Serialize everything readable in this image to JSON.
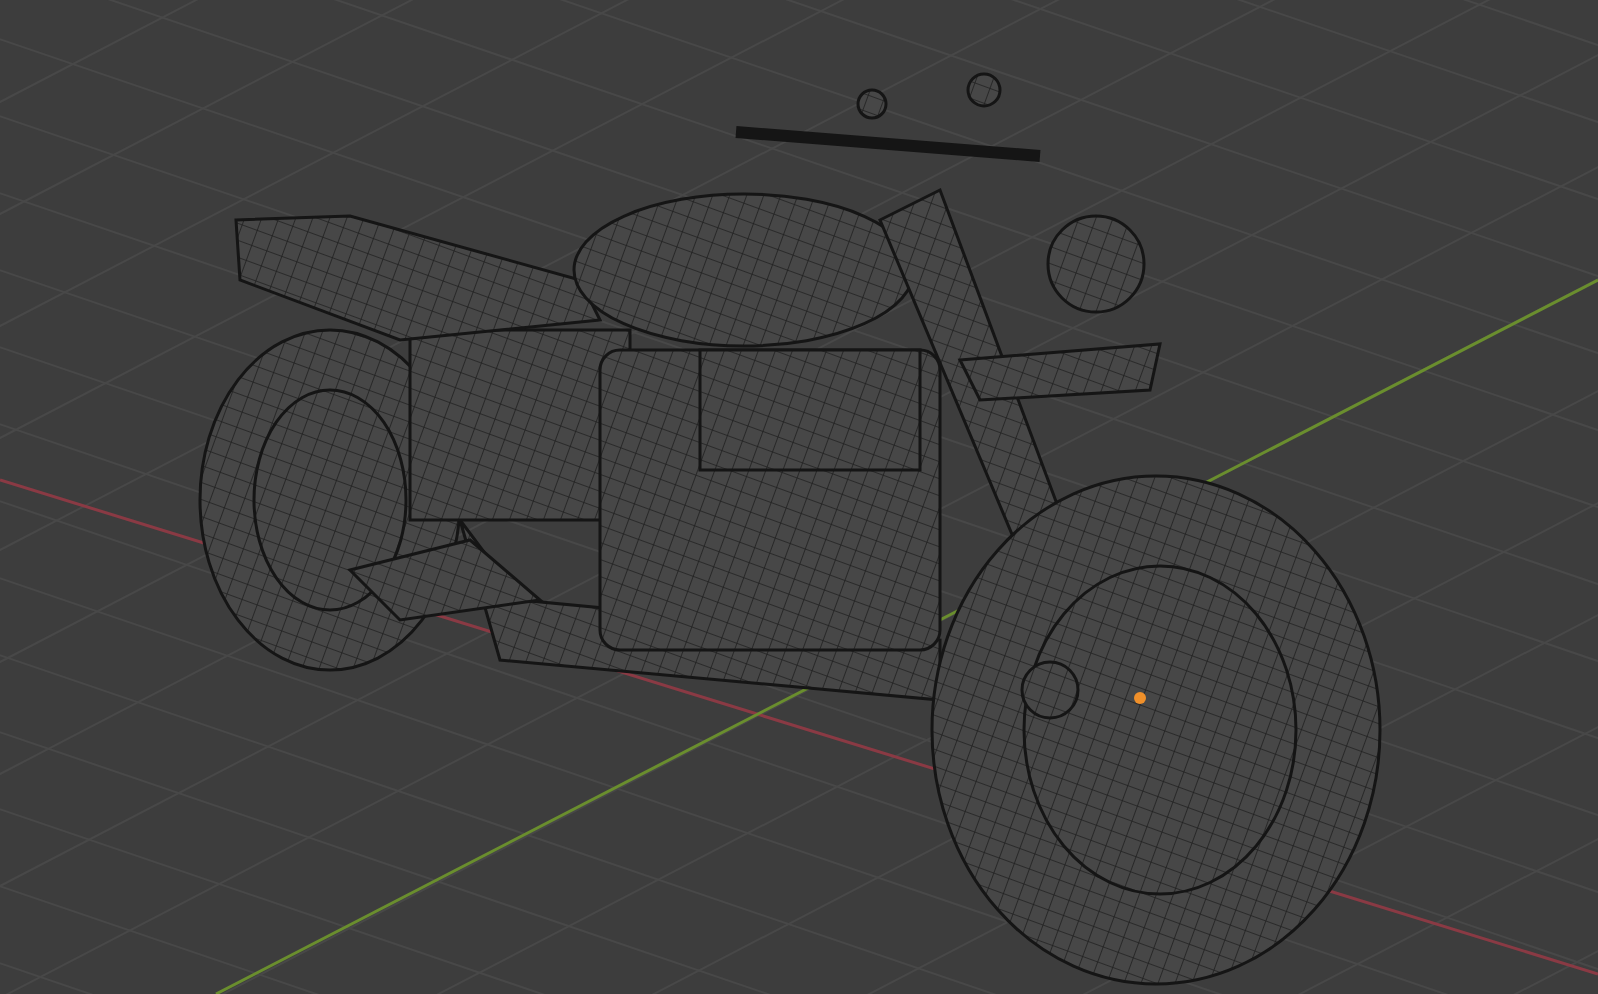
{
  "viewport": {
    "wireframe": true,
    "show_floor_grid": true,
    "show_origin": true
  }
}
